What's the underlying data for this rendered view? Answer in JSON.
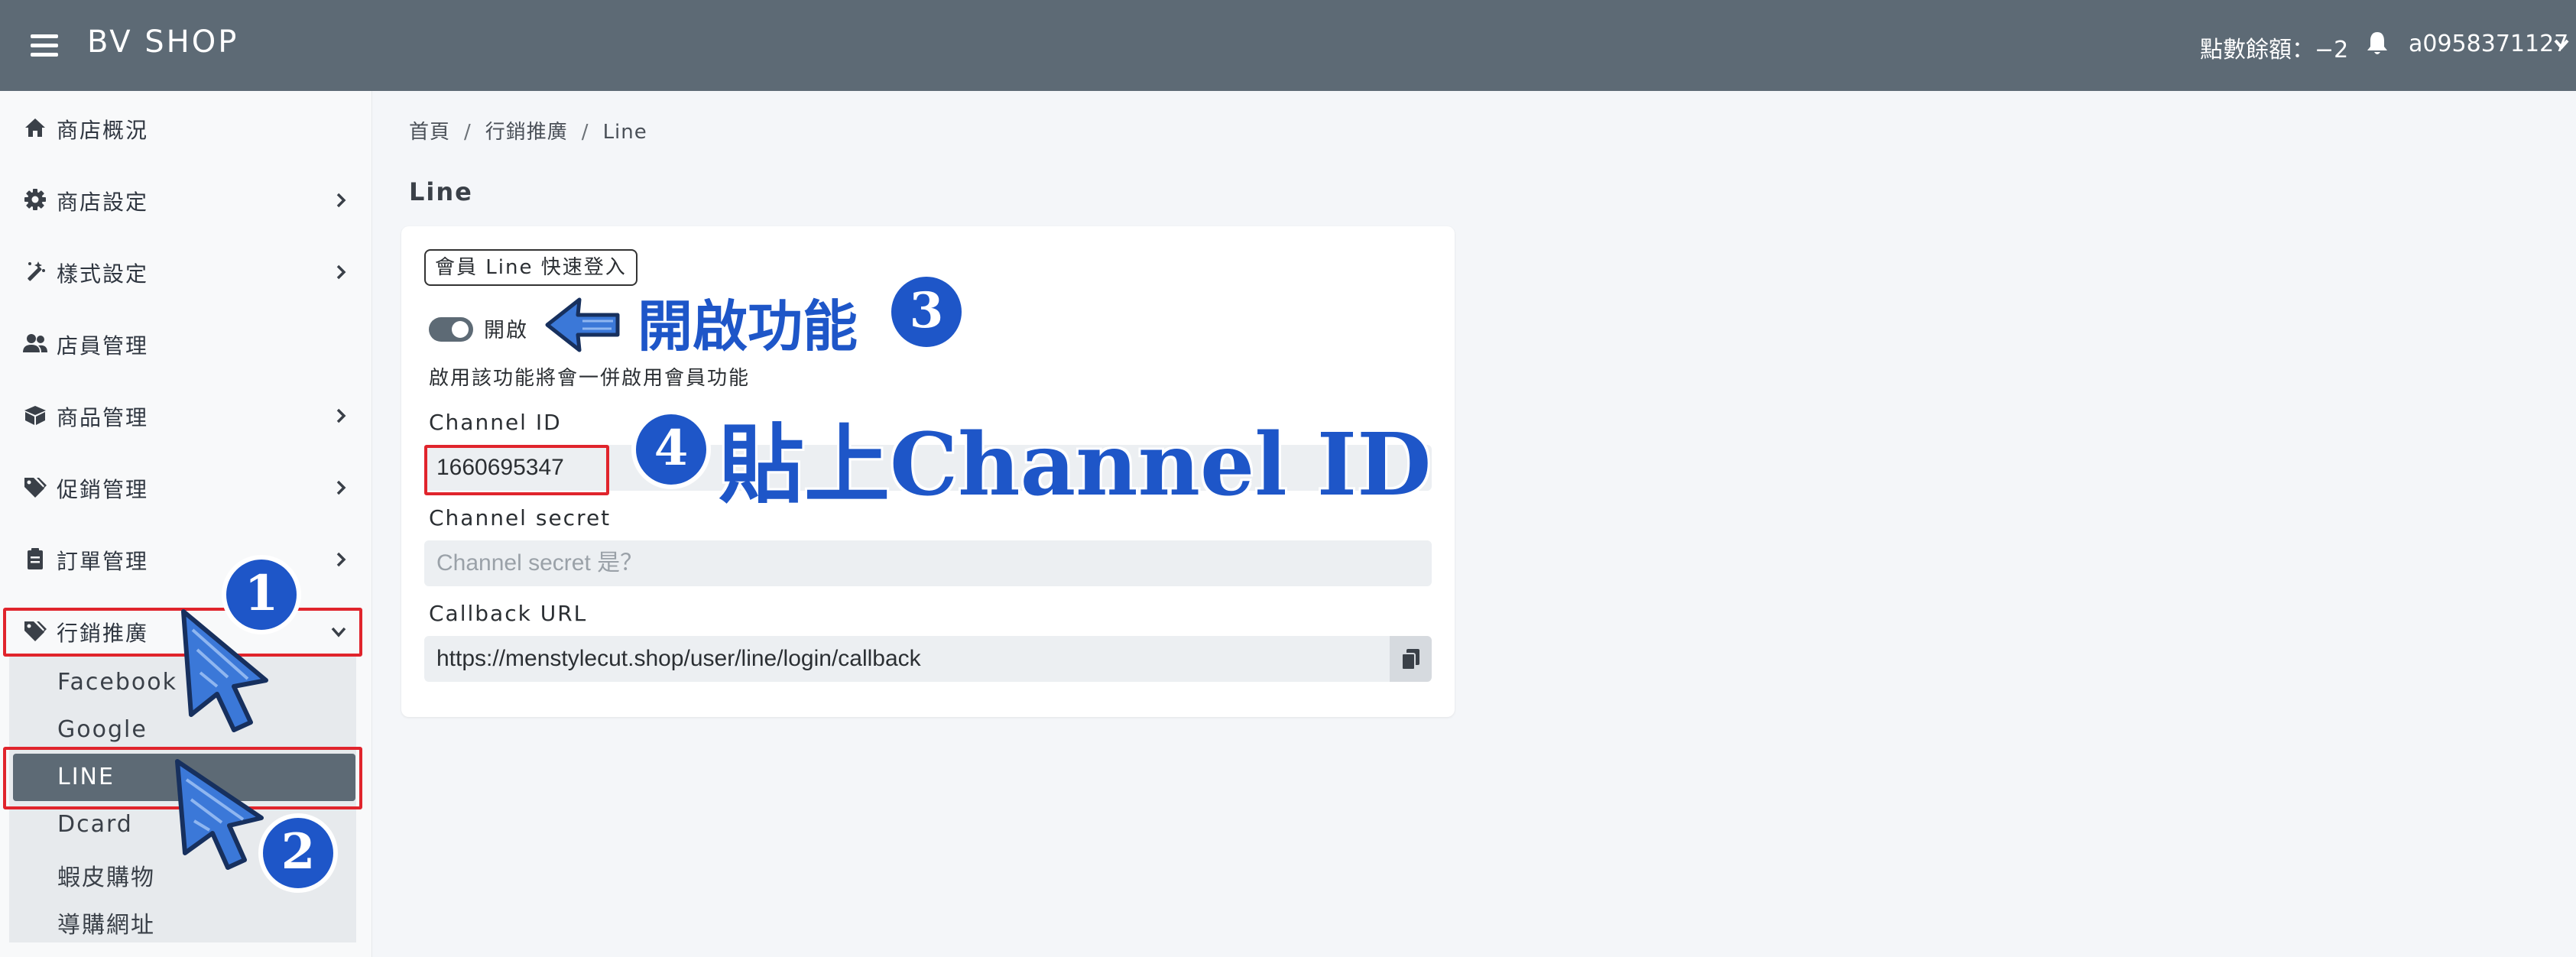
{
  "header": {
    "brand": "BV SHOP",
    "points": "點數餘額：−2",
    "username": "a0958371127"
  },
  "sidebar": {
    "items": [
      {
        "label": "商店概況",
        "icon": "home-icon"
      },
      {
        "label": "商店設定",
        "icon": "gear-icon"
      },
      {
        "label": "樣式設定",
        "icon": "magic-wand-icon"
      },
      {
        "label": "店員管理",
        "icon": "users-icon"
      },
      {
        "label": "商品管理",
        "icon": "box-icon"
      },
      {
        "label": "促銷管理",
        "icon": "tags-icon"
      },
      {
        "label": "訂單管理",
        "icon": "clipboard-icon"
      },
      {
        "label": "行銷推廣",
        "icon": "tags-icon"
      }
    ],
    "submenu": [
      "Facebook",
      "Google",
      "LINE",
      "Dcard",
      "蝦皮購物",
      "導購網址"
    ],
    "active_submenu": "LINE"
  },
  "breadcrumb": [
    "首頁",
    "行銷推廣",
    "Line"
  ],
  "page": {
    "title": "Line",
    "card_tag": "會員 Line 快速登入",
    "toggle_label": "開啟",
    "toggle_on": true,
    "hint": "啟用該功能將會一併啟用會員功能",
    "channel_id_label": "Channel ID",
    "channel_id_value": "1660695347",
    "channel_secret_label": "Channel secret",
    "channel_secret_placeholder": "Channel secret 是？",
    "callback_label": "Callback URL",
    "callback_value": "https://menstylecut.shop/user/line/login/callback"
  },
  "annotations": {
    "step1": "1",
    "step2": "2",
    "step3": "3",
    "step3_text": "開啟功能",
    "step4": "4",
    "step4_text": "貼上Channel ID"
  },
  "colors": {
    "topbar": "#5d6a75",
    "annotation_blue": "#1e56c8",
    "highlight_red": "#e0242c"
  }
}
